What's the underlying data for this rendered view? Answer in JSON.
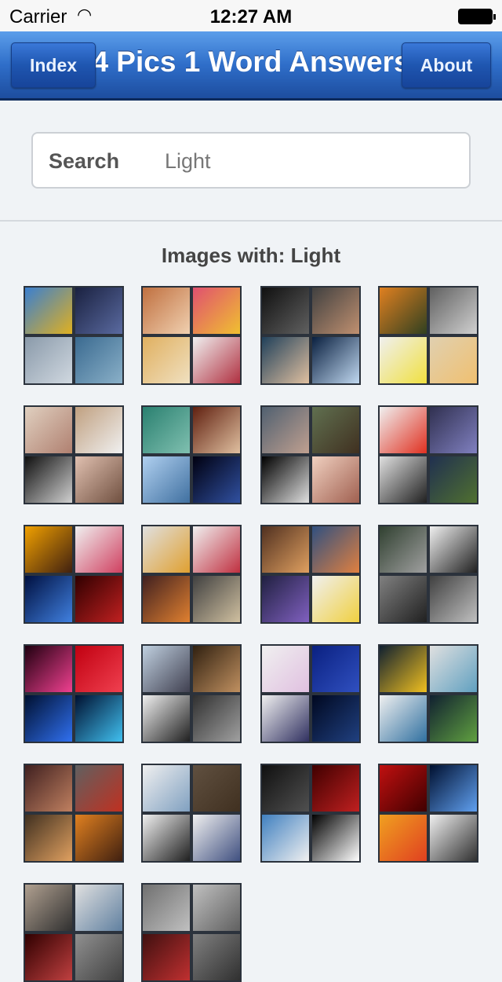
{
  "status": {
    "carrier": "Carrier",
    "time": "12:27 AM"
  },
  "nav": {
    "title": "4 Pics 1 Word Answers",
    "index_label": "Index",
    "about_label": "About"
  },
  "search": {
    "label": "Search",
    "value": "Light"
  },
  "results": {
    "heading": "Images with: Light"
  },
  "puzzles": [
    [
      "#3a7fd0,#e0b020",
      "#1a2140,#5a6aa0",
      "#8a9aaa,#d0d8e0",
      "#3a6a90,#8ab0c8"
    ],
    [
      "#c07040,#f0d0b0",
      "#e05070,#f0c030",
      "#e0b060,#f0e0c0",
      "#f0f0f0,#b03040"
    ],
    [
      "#101010,#606060",
      "#404040,#c09070",
      "#20405a,#e0c0a0",
      "#0a2040,#c0d8f0"
    ],
    [
      "#e08020,#304020",
      "#606060,#d0d0d0",
      "#f0f0f0,#f0e040",
      "#e0d0b0,#f0c070"
    ],
    [
      "#e0d0c0,#b08070",
      "#c0a080,#f0f0f0",
      "#101010,#d0d0d0",
      "#e0c0b0,#705040"
    ],
    [
      "#2a8070,#80c0b0",
      "#602010,#e0c0a0",
      "#b0d0f0,#4070a0",
      "#000010,#3050a0"
    ],
    [
      "#506070,#c0a090",
      "#607050,#403020",
      "#000000,#e0e0e0",
      "#f0d0c0,#a06050"
    ],
    [
      "#f0f0f0,#e03020",
      "#303050,#8080c0",
      "#e0e0e0,#202020",
      "#203050,#507030"
    ],
    [
      "#f0a000,#402010",
      "#f0f0f0,#d04060",
      "#001040,#4080e0",
      "#300000,#c02020"
    ],
    [
      "#e0e0e0,#e0a030",
      "#f0f0f0,#c03040",
      "#402020,#e08030",
      "#404040,#d0c0a0"
    ],
    [
      "#503020,#e0a060",
      "#305080,#e08040",
      "#202040,#8060c0",
      "#f0f0f0,#f0d040"
    ],
    [
      "#304030,#a0a0a0",
      "#f0f0f0,#202020",
      "#808080,#202020",
      "#404040,#c0c0c0"
    ],
    [
      "#200010,#f04090",
      "#c00010,#f04050",
      "#001030,#3070f0",
      "#001030,#40c0f0"
    ],
    [
      "#c0d0e0,#404050",
      "#302010,#c09060",
      "#f0f0f0,#202020",
      "#303030,#a0a0a0"
    ],
    [
      "#f0f0f0,#e0c0e0",
      "#0a2080,#3050c0",
      "#f0f0f0,#303060",
      "#000820,#204080"
    ],
    [
      "#102030,#f0c020",
      "#e0e0e0,#60a0c0",
      "#f0f0f0,#3070a0",
      "#102030,#60a040"
    ],
    [
      "#402020,#c08060",
      "#606060,#c03020",
      "#403020,#e0a060",
      "#e08020,#402010"
    ],
    [
      "#f0f0f0,#80a0c0",
      "#605040,#403020",
      "#f0f0f0,#202020",
      "#f0f0f0,#405080"
    ],
    [
      "#101010,#505050",
      "#400000,#c02020",
      "#4080c0,#f0f0f0",
      "#000000,#ffffff"
    ],
    [
      "#c01010,#400000",
      "#001030,#60a0f0",
      "#f0a020,#e04020",
      "#f0f0f0,#303030"
    ],
    [
      "#b0a090,#303030",
      "#e0e0e0,#6080a0",
      "#300000,#c04040",
      "#909090,#404040"
    ],
    [
      "#707070,#c0c0c0",
      "#c0c0c0,#606060",
      "#401010,#c03030",
      "#808080,#303030"
    ]
  ]
}
